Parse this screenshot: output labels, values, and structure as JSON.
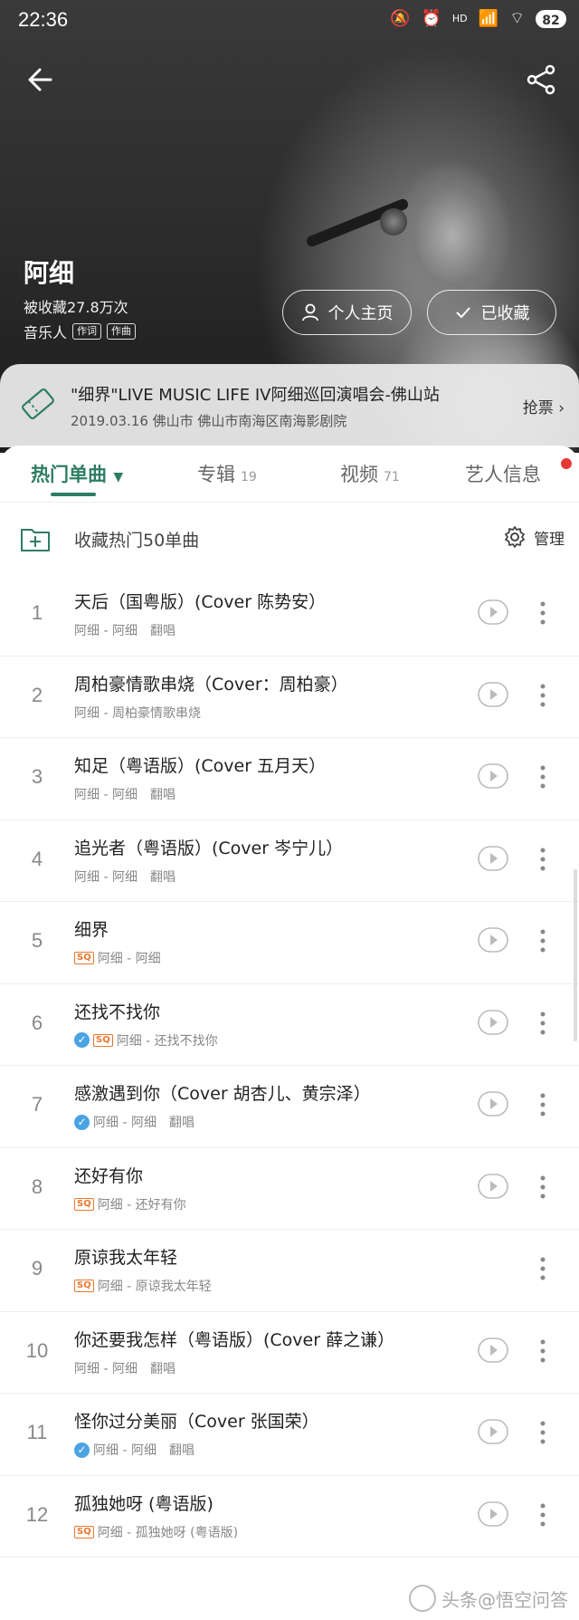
{
  "status": {
    "time": "22:36",
    "battery": "82",
    "network": "HD"
  },
  "artist": {
    "name": "阿细",
    "favorited": "被收藏27.8万次",
    "role": "音乐人",
    "tags": [
      "作词",
      "作曲"
    ],
    "home_button": "个人主页",
    "fav_button": "已收藏"
  },
  "concert": {
    "title": "\"细界\"LIVE MUSIC LIFE IV阿细巡回演唱会-佛山站",
    "subtitle": "2019.03.16 佛山市 佛山市南海区南海影剧院",
    "action": "抢票"
  },
  "tabs": [
    {
      "label": "热门单曲",
      "count": ""
    },
    {
      "label": "专辑",
      "count": "19"
    },
    {
      "label": "视频",
      "count": "71"
    },
    {
      "label": "艺人信息",
      "count": ""
    }
  ],
  "collect": {
    "label": "收藏热门50单曲",
    "manage": "管理"
  },
  "songs": [
    {
      "idx": "1",
      "name": "天后（国粤版）(Cover 陈势安）",
      "meta": "阿细 - 阿细　翻唱"
    },
    {
      "idx": "2",
      "name": "周柏豪情歌串烧（Cover：周柏豪）",
      "meta": "阿细 - 周柏豪情歌串烧"
    },
    {
      "idx": "3",
      "name": "知足（粤语版）(Cover 五月天）",
      "meta": "阿细 - 阿细　翻唱"
    },
    {
      "idx": "4",
      "name": "追光者（粤语版）(Cover 岑宁儿）",
      "meta": "阿细 - 阿细　翻唱"
    },
    {
      "idx": "5",
      "name": "细界",
      "meta": "阿细 - 阿细"
    },
    {
      "idx": "6",
      "name": "还找不找你",
      "meta": "阿细 - 还找不找你"
    },
    {
      "idx": "7",
      "name": "感激遇到你（Cover 胡杏儿、黄宗泽）",
      "meta": "阿细 - 阿细　翻唱"
    },
    {
      "idx": "8",
      "name": "还好有你",
      "meta": "阿细 - 还好有你"
    },
    {
      "idx": "9",
      "name": "原谅我太年轻",
      "meta": "阿细 - 原谅我太年轻"
    },
    {
      "idx": "10",
      "name": "你还要我怎样（粤语版）(Cover 薛之谦）",
      "meta": "阿细 - 阿细　翻唱"
    },
    {
      "idx": "11",
      "name": "怪你过分美丽（Cover 张国荣）",
      "meta": "阿细 - 阿细　翻唱"
    },
    {
      "idx": "12",
      "name": "孤独她呀 (粤语版)",
      "meta": "阿细 - 孤独她呀 (粤语版)"
    }
  ],
  "badges": {
    "sq": "SQ"
  },
  "watermark": "头条@悟空问答",
  "colors": {
    "accent": "#2e7d63",
    "sq": "#e8772e",
    "check": "#4ba3e3",
    "dot": "#e53935"
  }
}
